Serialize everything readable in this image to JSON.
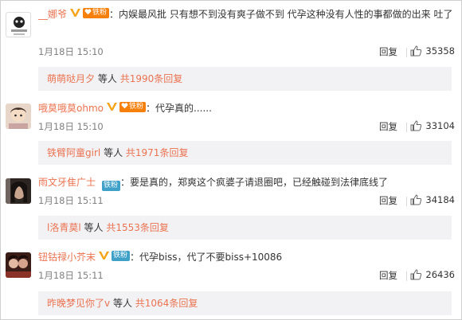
{
  "comments": [
    {
      "user": "__娜爷",
      "fan_label": "铁粉",
      "fan_style": "gold",
      "has_v": true,
      "text": "内娱最风批 只有想不到没有爽子做不到 代孕这种没有人性的事都做的出来 吐了",
      "time": "1月18日 15:10",
      "reply_label": "回复",
      "likes": "35358",
      "sub": {
        "user": "萌萌哒月夕",
        "mid": "等人",
        "more": "共1990条回复"
      }
    },
    {
      "user": "哦莫哦莫ohmo",
      "fan_label": "铁粉",
      "fan_style": "gold",
      "has_v": true,
      "text": "代孕真的......",
      "time": "1月18日 15:10",
      "reply_label": "回复",
      "likes": "33104",
      "sub": {
        "user": "铁臂阿童girl",
        "mid": "等人",
        "more": "共1971条回复"
      }
    },
    {
      "user": "雨文牙隹广士",
      "fan_label": "铁粉",
      "fan_style": "blue",
      "has_v": false,
      "text": "要是真的，郑爽这个疯婆子请退圈吧，已经触碰到法律底线了",
      "time": "1月18日 15:11",
      "reply_label": "回复",
      "likes": "34184",
      "sub": {
        "user": "l洛青莫l",
        "mid": "等人",
        "more": "共1553条回复"
      }
    },
    {
      "user": "钮钴禄小芥末",
      "fan_label": "铁粉",
      "fan_style": "blue",
      "has_v": true,
      "text": "代孕biss，代了不要biss+10086",
      "time": "1月18日 15:11",
      "reply_label": "回复",
      "likes": "26436",
      "sub": {
        "user": "昨晚梦见你了v",
        "mid": "等人",
        "more": "共1064条回复"
      }
    }
  ],
  "colors": {
    "link": "#eb7350",
    "fan_gold": "#f77f0c",
    "fan_blue": "#3fa0c8",
    "subbox_bg": "#f2f2f5"
  },
  "icons": [
    "heart-icon",
    "verified-v-icon",
    "thumbs-up-icon",
    "avatar-icon"
  ]
}
